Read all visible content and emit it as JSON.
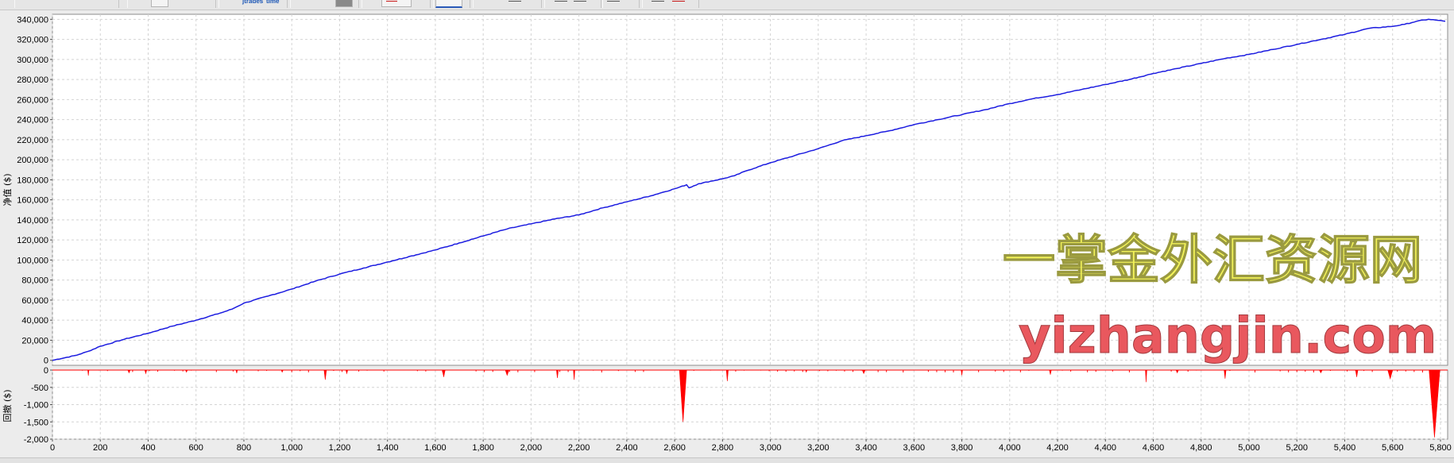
{
  "toolbar": {
    "trades_label": "jtrades",
    "time_label": "time"
  },
  "watermark": {
    "line1": "一掌金外汇资源网",
    "line2": "yizhangjin.com"
  },
  "chart_data": [
    {
      "type": "line",
      "panel": "equity",
      "ylabel": "净值 ($)",
      "ylim": [
        -5000,
        345000
      ],
      "yticks": [
        0,
        20000,
        40000,
        60000,
        80000,
        100000,
        120000,
        140000,
        160000,
        180000,
        200000,
        220000,
        240000,
        260000,
        280000,
        300000,
        320000,
        340000
      ],
      "ytick_labels": [
        "0",
        "20,000",
        "40,000",
        "60,000",
        "80,000",
        "100,000",
        "120,000",
        "140,000",
        "160,000",
        "180,000",
        "200,000",
        "220,000",
        "240,000",
        "260,000",
        "280,000",
        "300,000",
        "320,000",
        "340,000"
      ],
      "xlim": [
        0,
        5830
      ],
      "grid": true,
      "color": "#1c1ce0",
      "series": [
        {
          "x": [
            0,
            100,
            150,
            200,
            300,
            400,
            500,
            600,
            700,
            750,
            800,
            900,
            1000,
            1100,
            1200,
            1300,
            1400,
            1500,
            1600,
            1700,
            1800,
            1900,
            2000,
            2100,
            2200,
            2300,
            2400,
            2500,
            2600,
            2650,
            2660,
            2700,
            2800,
            2850,
            2900,
            3000,
            3100,
            3200,
            3300,
            3400,
            3500,
            3600,
            3700,
            3800,
            3900,
            4000,
            4100,
            4200,
            4300,
            4400,
            4500,
            4600,
            4700,
            4800,
            4900,
            5000,
            5100,
            5200,
            5300,
            5400,
            5500,
            5600,
            5650,
            5700,
            5750,
            5790,
            5820
          ],
          "y": [
            0,
            5000,
            9000,
            14000,
            21000,
            27000,
            34000,
            40000,
            47000,
            51000,
            57000,
            64000,
            71000,
            79000,
            86000,
            92000,
            98000,
            104000,
            110000,
            117000,
            124000,
            131000,
            136000,
            141000,
            145000,
            152000,
            158000,
            164000,
            171000,
            175000,
            172000,
            176000,
            181000,
            184000,
            189000,
            197000,
            204000,
            211000,
            219000,
            224000,
            229000,
            235000,
            240000,
            245000,
            250000,
            256000,
            261000,
            265000,
            270000,
            275000,
            280000,
            286000,
            291000,
            296000,
            301000,
            305000,
            310000,
            315000,
            320000,
            325000,
            331000,
            333000,
            335000,
            338000,
            340000,
            339000,
            338000
          ]
        }
      ]
    },
    {
      "type": "area",
      "panel": "drawdown",
      "ylabel": "回撤 ($)",
      "ylim": [
        -2000,
        0
      ],
      "yticks": [
        0,
        -500,
        -1000,
        -1500,
        -2000
      ],
      "ytick_labels": [
        "0",
        "-500",
        "-1,000",
        "-1,500",
        "-2,000"
      ],
      "xlim": [
        0,
        5830
      ],
      "xticks": [
        0,
        200,
        400,
        600,
        800,
        1000,
        1200,
        1400,
        1600,
        1800,
        2000,
        2200,
        2400,
        2600,
        2800,
        3000,
        3200,
        3400,
        3600,
        3800,
        4000,
        4200,
        4400,
        4600,
        4800,
        5000,
        5200,
        5400,
        5600,
        5800
      ],
      "xtick_labels": [
        "0",
        "200",
        "400",
        "600",
        "800",
        "1,000",
        "1,200",
        "1,400",
        "1,600",
        "1,800",
        "2,000",
        "2,200",
        "2,400",
        "2,600",
        "2,800",
        "3,000",
        "3,200",
        "3,400",
        "3,600",
        "3,800",
        "4,000",
        "4,200",
        "4,400",
        "4,600",
        "4,800",
        "5,000",
        "5,200",
        "5,400",
        "5,600",
        "5,800"
      ],
      "grid": true,
      "color": "#ff0000",
      "events": [
        {
          "x": 150,
          "depth": 160,
          "width": 5
        },
        {
          "x": 320,
          "depth": 80,
          "width": 10
        },
        {
          "x": 390,
          "depth": 100,
          "width": 8
        },
        {
          "x": 560,
          "depth": 60,
          "width": 8
        },
        {
          "x": 770,
          "depth": 90,
          "width": 6
        },
        {
          "x": 960,
          "depth": 60,
          "width": 8
        },
        {
          "x": 1140,
          "depth": 280,
          "width": 10
        },
        {
          "x": 1230,
          "depth": 100,
          "width": 8
        },
        {
          "x": 1635,
          "depth": 200,
          "width": 12
        },
        {
          "x": 1900,
          "depth": 150,
          "width": 15
        },
        {
          "x": 2110,
          "depth": 230,
          "width": 8
        },
        {
          "x": 2180,
          "depth": 280,
          "width": 6
        },
        {
          "x": 2635,
          "depth": 1500,
          "width": 30
        },
        {
          "x": 2820,
          "depth": 320,
          "width": 8
        },
        {
          "x": 3150,
          "depth": 60,
          "width": 6
        },
        {
          "x": 3390,
          "depth": 100,
          "width": 12
        },
        {
          "x": 3800,
          "depth": 150,
          "width": 6
        },
        {
          "x": 4170,
          "depth": 130,
          "width": 8
        },
        {
          "x": 4570,
          "depth": 350,
          "width": 6
        },
        {
          "x": 4700,
          "depth": 80,
          "width": 10
        },
        {
          "x": 4900,
          "depth": 250,
          "width": 8
        },
        {
          "x": 5300,
          "depth": 80,
          "width": 12
        },
        {
          "x": 5450,
          "depth": 200,
          "width": 10
        },
        {
          "x": 5590,
          "depth": 250,
          "width": 20
        },
        {
          "x": 5775,
          "depth": 1950,
          "width": 45
        }
      ]
    }
  ]
}
